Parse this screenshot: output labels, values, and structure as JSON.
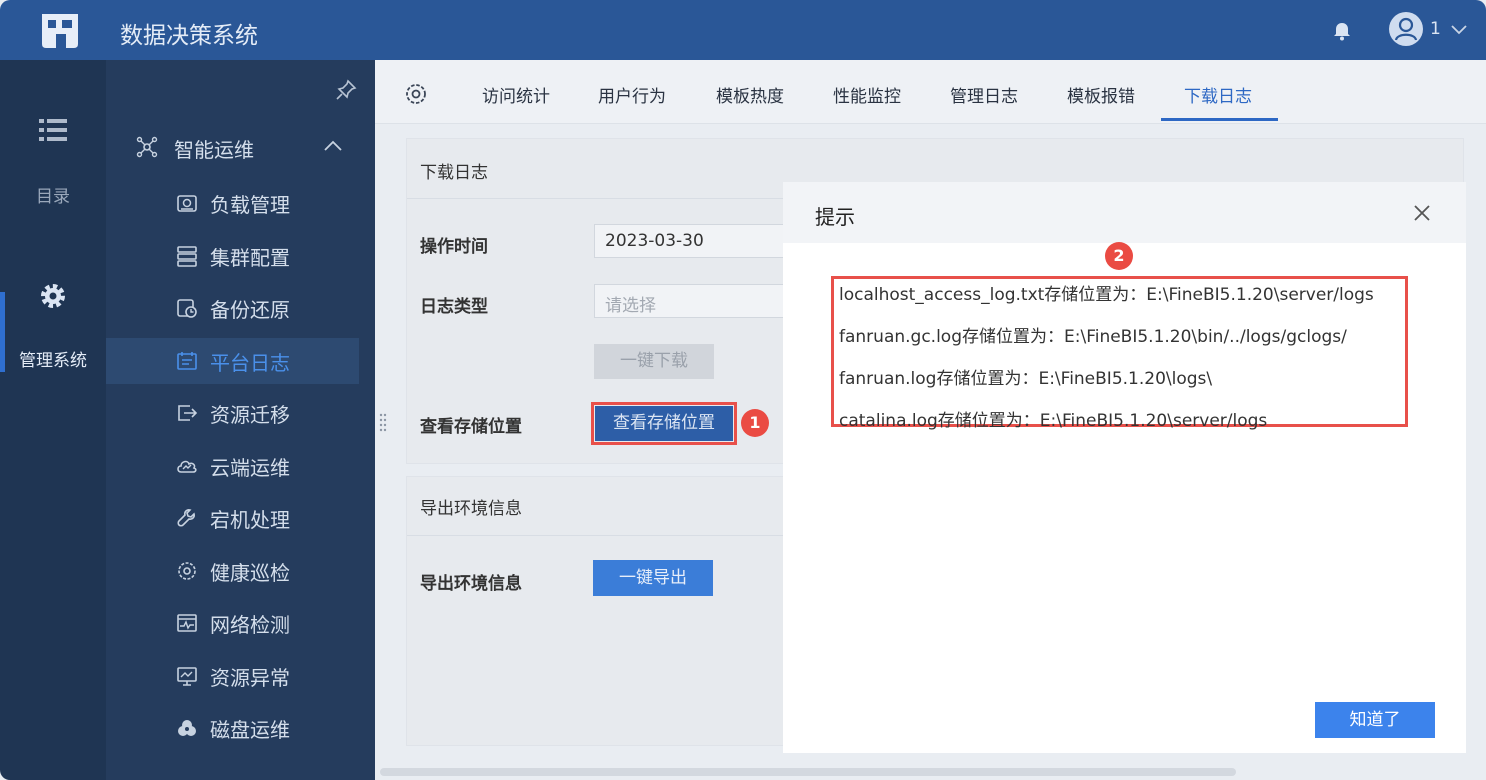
{
  "app": {
    "title": "数据决策系统",
    "user_name": "1"
  },
  "rail": {
    "items": [
      {
        "label": "目录",
        "icon": "list-icon"
      },
      {
        "label": "管理系统",
        "icon": "gear-icon"
      }
    ]
  },
  "sidebar": {
    "group_label": "智能运维",
    "items": [
      {
        "label": "负载管理",
        "icon": "load-icon"
      },
      {
        "label": "集群配置",
        "icon": "cluster-icon"
      },
      {
        "label": "备份还原",
        "icon": "backup-icon"
      },
      {
        "label": "平台日志",
        "icon": "log-icon",
        "active": true
      },
      {
        "label": "资源迁移",
        "icon": "migrate-icon"
      },
      {
        "label": "云端运维",
        "icon": "cloud-icon"
      },
      {
        "label": "宕机处理",
        "icon": "wrench-icon"
      },
      {
        "label": "健康巡检",
        "icon": "health-gear-icon"
      },
      {
        "label": "网络检测",
        "icon": "network-icon"
      },
      {
        "label": "资源异常",
        "icon": "monitor-icon"
      },
      {
        "label": "磁盘运维",
        "icon": "disk-icon"
      }
    ]
  },
  "tabs": [
    "访问统计",
    "用户行为",
    "模板热度",
    "性能监控",
    "管理日志",
    "模板报错",
    "下载日志"
  ],
  "active_tab": "下载日志",
  "download_card": {
    "title": "下载日志",
    "op_time_label": "操作时间",
    "op_time_value": "2023-03-30",
    "log_type_label": "日志类型",
    "log_type_placeholder": "请选择",
    "download_button": "一键下载",
    "view_storage_label": "查看存储位置",
    "view_storage_button": "查看存储位置"
  },
  "export_card": {
    "title": "导出环境信息",
    "label": "导出环境信息",
    "button": "一键导出"
  },
  "badges": [
    "1",
    "2"
  ],
  "modal": {
    "title": "提示",
    "paths": [
      "localhost_access_log.txt存储位置为：E:\\FineBI5.1.20\\server/logs",
      "fanruan.gc.log存储位置为：E:\\FineBI5.1.20\\bin/../logs/gclogs/",
      "fanruan.log存储位置为：E:\\FineBI5.1.20\\logs\\",
      "catalina.log存储位置为：E:\\FineBI5.1.20\\server/logs"
    ],
    "ok_button": "知道了"
  },
  "colors": {
    "topbar": "#2a5797",
    "rail": "#1f3553",
    "sidebar": "#253c5d",
    "accent": "#2d68c4",
    "highlight": "#e8504a",
    "ok_button": "#3c83ec"
  }
}
